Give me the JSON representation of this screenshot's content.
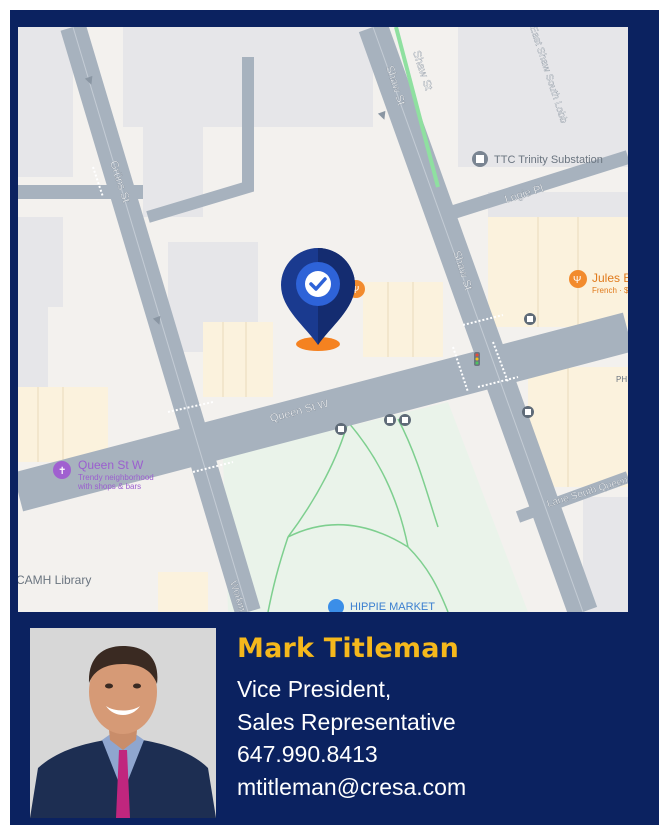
{
  "map": {
    "streets": {
      "shaw_st_north": "Shaw St",
      "shaw_st_south": "Shaw St",
      "gruns_st": "Grüns St",
      "queen_st_w": "Queen St W",
      "logie_pl": "Logie Pl",
      "east_shaw_south_lobb": "East Shaw South Lobb",
      "lane_south_queen": "Lane South Queen",
      "workman": "Workm"
    },
    "places": {
      "ttc_substation": "TTC Trinity Substation",
      "jules_bistro_name": "Jules Bist",
      "jules_bistro_sub": "French · $$",
      "queen_st_w_poi_name": "Queen St W",
      "queen_st_w_poi_sub_1": "Trendy neighborhood",
      "queen_st_w_poi_sub_2": "with shops & bars",
      "camh_library": "CAMH Library",
      "hippie_market": "HIPPIE MARKET",
      "ph_label": "PH"
    },
    "marker_icon": "check-location-pin-icon"
  },
  "agent": {
    "name": "Mark Titleman",
    "title_line1": "Vice President,",
    "title_line2": "Sales Representative",
    "phone": "647.990.8413",
    "email": "mtitleman@cresa.com"
  },
  "colors": {
    "card_bg": "#0b2260",
    "name_gold": "#f5b81c",
    "marker_blue": "#1a3a8f",
    "marker_orange": "#f58220"
  }
}
